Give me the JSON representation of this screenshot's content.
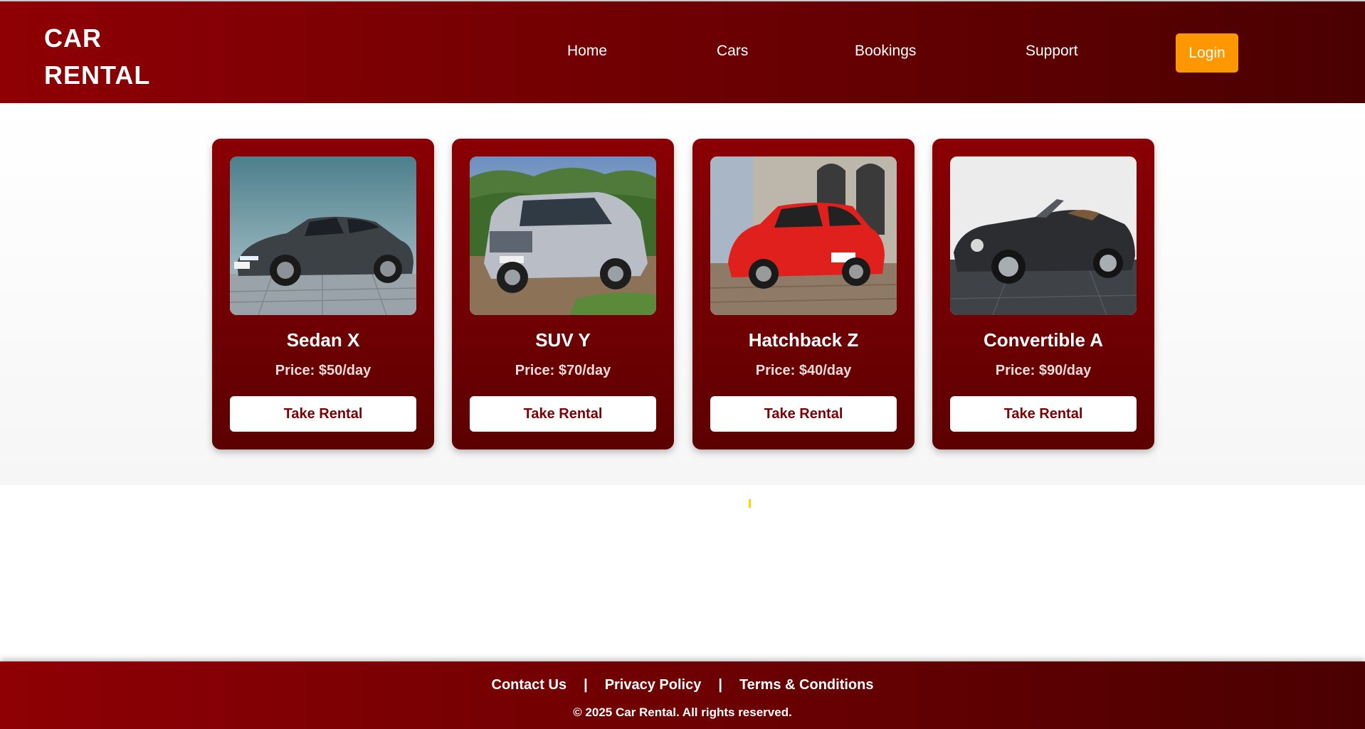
{
  "header": {
    "logo_line1": "CAR",
    "logo_line2": "RENTAL",
    "nav": [
      "Home",
      "Cars",
      "Bookings",
      "Support"
    ],
    "login_label": "Login"
  },
  "cars": [
    {
      "name": "Sedan X",
      "price": "Price: $50/day",
      "button": "Take Rental",
      "image": "sedan-photo"
    },
    {
      "name": "SUV Y",
      "price": "Price: $70/day",
      "button": "Take Rental",
      "image": "suv-photo"
    },
    {
      "name": "Hatchback Z",
      "price": "Price: $40/day",
      "button": "Take Rental",
      "image": "hatchback-photo"
    },
    {
      "name": "Convertible A",
      "price": "Price: $90/day",
      "button": "Take Rental",
      "image": "convertible-photo"
    }
  ],
  "footer": {
    "links": [
      "Contact Us",
      "Privacy Policy",
      "Terms & Conditions"
    ],
    "separator": "|",
    "copyright": "© 2025 Car Rental. All rights reserved."
  },
  "colors": {
    "brand_red": "#8e0004",
    "brand_dark": "#4a0001",
    "login_orange": "#ff9800",
    "button_text": "#7a0003"
  }
}
